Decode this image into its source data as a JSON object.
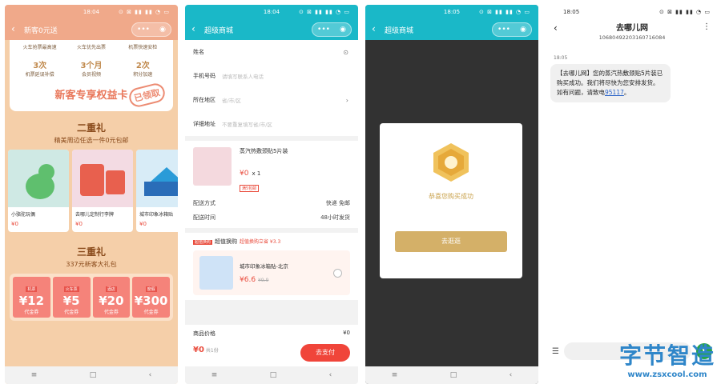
{
  "p1": {
    "time": "18:04",
    "status_icons": "⊙ ⊠ ▮▮ ▮▮ ◔ ▭",
    "title": "新客0元送",
    "perks": [
      {
        "big": "",
        "label": "火车抢票最高速"
      },
      {
        "big": "",
        "label": "火车优先出票"
      },
      {
        "big": "",
        "label": "机票快速安检"
      }
    ],
    "perks2": [
      {
        "big": "3次",
        "label": "机票延误补偿"
      },
      {
        "big": "3个月",
        "label": "会员视频"
      },
      {
        "big": "2次",
        "label": "积分加速"
      }
    ],
    "card_title": "新客专享权益卡",
    "stamp": "已领取",
    "sec2_title": "二重礼",
    "sec2_sub": "精美周边任选一件0元包邮",
    "products": [
      {
        "name": "小骆驼玩偶",
        "price": "¥0"
      },
      {
        "name": "去哪儿定制行李牌",
        "price": "¥0"
      },
      {
        "name": "城市印象冰箱贴",
        "price": "¥0"
      }
    ],
    "sec3_title": "三重礼",
    "sec3_sub": "337元新客大礼包",
    "coupons": [
      {
        "tag": "机票",
        "amt": "¥12",
        "lbl": "代金券"
      },
      {
        "tag": "火车票",
        "amt": "¥5",
        "lbl": "代金券"
      },
      {
        "tag": "酒店",
        "amt": "¥20",
        "lbl": "代金券"
      },
      {
        "tag": "度假",
        "amt": "¥300",
        "lbl": "代金券"
      }
    ]
  },
  "p2": {
    "time": "18:04",
    "title": "超级商城",
    "fields": [
      {
        "label": "姓名",
        "ph": ""
      },
      {
        "label": "手机号码",
        "ph": "请填写联系人电话"
      },
      {
        "label": "所在地区",
        "ph": "省/市/区"
      },
      {
        "label": "详细地址",
        "ph": "不要重复填写省/市/区"
      }
    ],
    "goods_name": "蒸汽热敷颈贴5片装",
    "goods_price": "¥0",
    "goods_qty": "x 1",
    "goods_tag": "满5包邮",
    "ship_label": "配送方式",
    "ship_value": "快递 免邮",
    "time_label": "配送时间",
    "time_value": "48小时发货",
    "upsell_badge": "超值换购",
    "upsell_title": "超值换购",
    "upsell_note": "超值换购立省 ¥3.3",
    "upsell_name": "城市印象冰箱贴-北京",
    "upsell_price": "¥6.6",
    "upsell_old": "¥9.9",
    "price_label": "商品价格",
    "price_value": "¥0",
    "total": "¥0",
    "total_count": "共1份",
    "pay_btn": "去支付"
  },
  "p3": {
    "time": "18:05",
    "title": "超级商城",
    "message": "恭喜您购买成功",
    "button": "去逛逛"
  },
  "p4": {
    "time": "18:05",
    "sender": "去哪儿网",
    "number": "10680492203160716084",
    "msg_time": "18:05",
    "msg_text": "【去哪儿网】您的蒸汽热敷颈贴5片装已购买成功。我们将尽快为您安排发货。如有问题，请致电",
    "msg_link": "95117",
    "msg_end": "。",
    "watermark": "字节智造",
    "watermark_url": "www.zsxcool.com"
  },
  "colors": {
    "teal": "#1ab8c8",
    "red": "#e94b3c",
    "gold": "#d4b068"
  }
}
